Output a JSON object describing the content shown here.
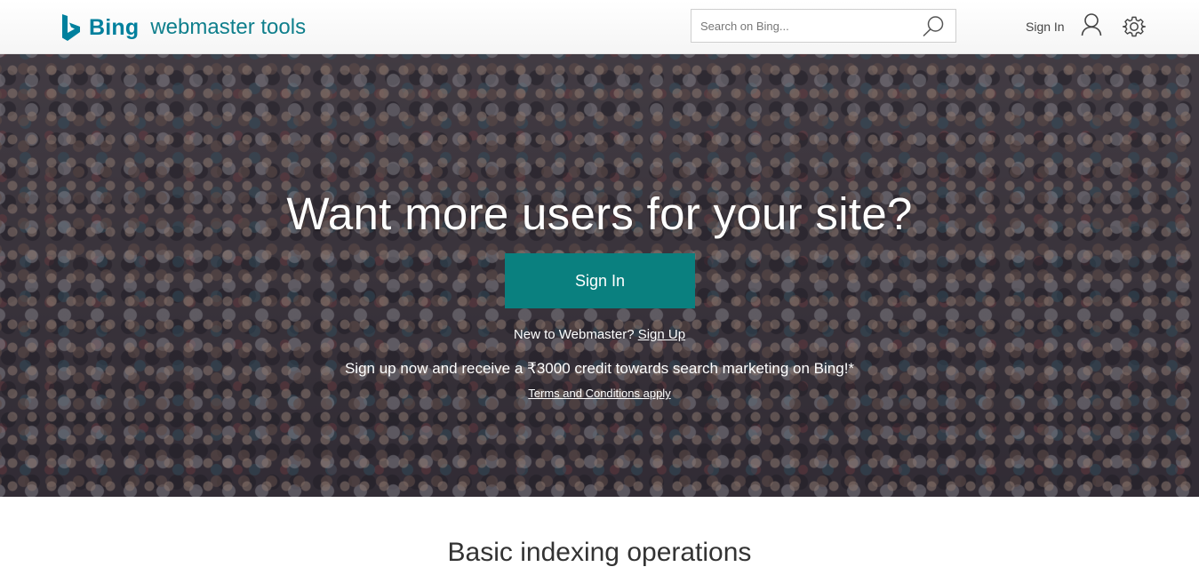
{
  "header": {
    "brand": "Bing",
    "product": "webmaster tools",
    "search": {
      "placeholder": "Search on Bing...",
      "value": ""
    },
    "sign_in_label": "Sign In",
    "icons": [
      "bing-logo-icon",
      "search-icon",
      "user-icon",
      "gear-icon"
    ]
  },
  "hero": {
    "title": "Want more users for your site?",
    "sign_in_button": "Sign In",
    "new_prefix": "New to Webmaster?",
    "sign_up_link": "Sign Up",
    "credit_text": "Sign up now and receive a ₹3000 credit towards search marketing on Bing!*",
    "terms_link": "Terms and Conditions apply"
  },
  "below": {
    "heading": "Basic indexing operations"
  },
  "colors": {
    "brand": "#00809d",
    "accent": "#0a807f"
  }
}
